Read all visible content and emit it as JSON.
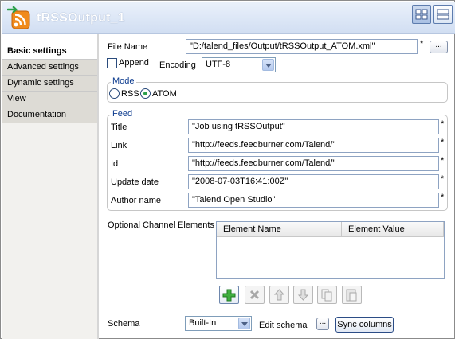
{
  "component": {
    "title": "tRSSOutput_1",
    "icon": "rss-output-icon"
  },
  "view_toggle": [
    {
      "icon": "grid-view-icon"
    },
    {
      "icon": "list-view-icon"
    }
  ],
  "tabs": [
    {
      "label": "Basic settings",
      "active": true
    },
    {
      "label": "Advanced settings",
      "active": false
    },
    {
      "label": "Dynamic settings",
      "active": false
    },
    {
      "label": "View",
      "active": false
    },
    {
      "label": "Documentation",
      "active": false
    }
  ],
  "file": {
    "label": "File Name",
    "value": "\"D:/talend_files/Output/tRSSOutput_ATOM.xml\"",
    "required": "*",
    "browse_label": "..."
  },
  "append": {
    "label": "Append",
    "checked": false
  },
  "encoding": {
    "label": "Encoding",
    "value": "UTF-8"
  },
  "mode": {
    "title": "Mode",
    "options": [
      "RSS",
      "ATOM"
    ],
    "selected": "ATOM"
  },
  "feed": {
    "title": "Feed",
    "fields": [
      {
        "label": "Title",
        "value": "\"Job using tRSSOutput\"",
        "required": "*"
      },
      {
        "label": "Link",
        "value": "\"http://feeds.feedburner.com/Talend/\"",
        "required": "*"
      },
      {
        "label": "Id",
        "value": "\"http://feeds.feedburner.com/Talend/\"",
        "required": "*"
      },
      {
        "label": "Update date",
        "value": "\"2008-07-03T16:41:00Z\"",
        "required": "*"
      },
      {
        "label": "Author name",
        "value": "\"Talend Open Studio\"",
        "required": "*"
      }
    ]
  },
  "optional_channel": {
    "label": "Optional Channel Elements",
    "columns": [
      "Element Name",
      "Element Value"
    ]
  },
  "table_toolbar": [
    {
      "icon": "add-plus-icon",
      "enabled": true
    },
    {
      "icon": "delete-x-icon",
      "enabled": false
    },
    {
      "icon": "move-up-icon",
      "enabled": false
    },
    {
      "icon": "move-down-icon",
      "enabled": false
    },
    {
      "icon": "copy-icon",
      "enabled": false
    },
    {
      "icon": "paste-icon",
      "enabled": false
    }
  ],
  "schema": {
    "label": "Schema",
    "value": "Built-In",
    "edit_label": "Edit schema",
    "edit_button": "...",
    "sync_label": "Sync columns"
  },
  "colors": {
    "header_bg": "#d6e2f4",
    "accent_green": "#2ba04a",
    "group_title": "#0b3a8e"
  }
}
